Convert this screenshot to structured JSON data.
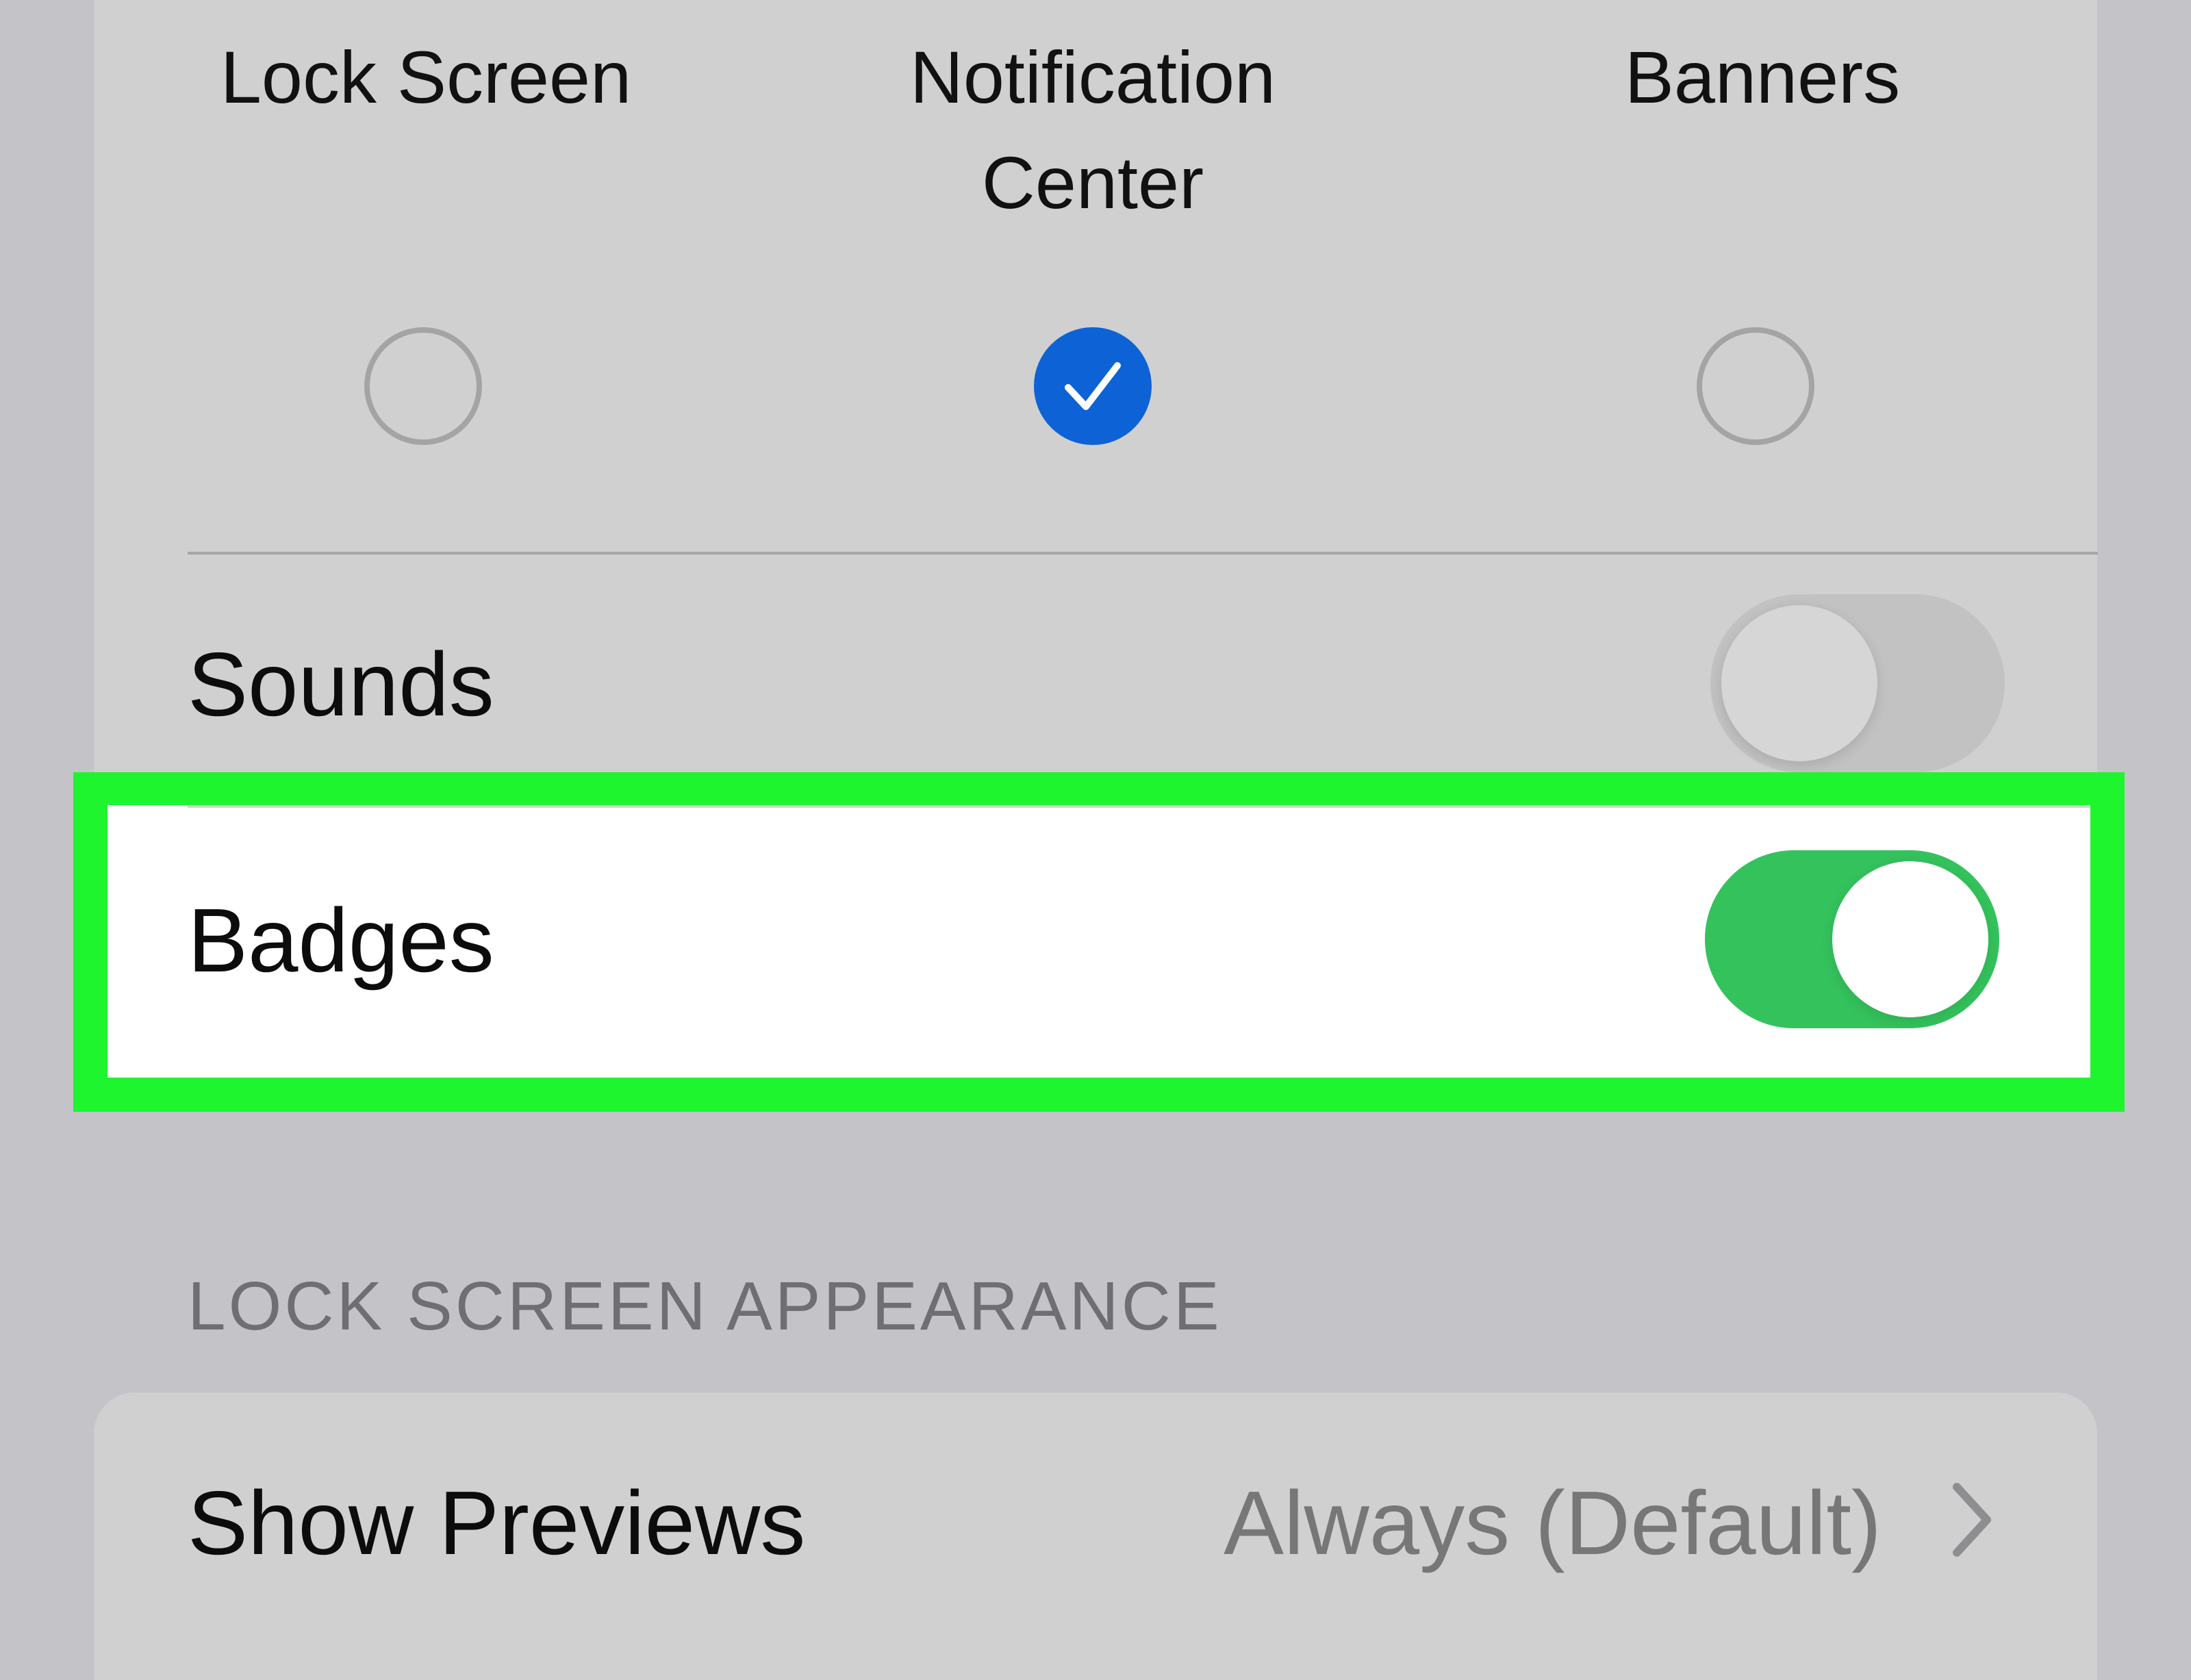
{
  "alerts": {
    "options": [
      {
        "label": "Lock Screen",
        "selected": false
      },
      {
        "label": "Notification\nCenter",
        "selected": true
      },
      {
        "label": "Banners",
        "selected": false
      }
    ]
  },
  "rows": {
    "sounds": {
      "label": "Sounds",
      "on": false
    },
    "badges": {
      "label": "Badges",
      "on": true
    }
  },
  "section": {
    "lock_screen_appearance": "LOCK SCREEN APPEARANCE"
  },
  "show_previews": {
    "label": "Show Previews",
    "value": "Always (Default)"
  },
  "colors": {
    "selected_radio": "#0d62d6",
    "toggle_on": "#34c25c",
    "highlight": "#1ef52e"
  },
  "icons": {
    "checked": "checkmark-icon",
    "chevron": "chevron-right-icon"
  }
}
